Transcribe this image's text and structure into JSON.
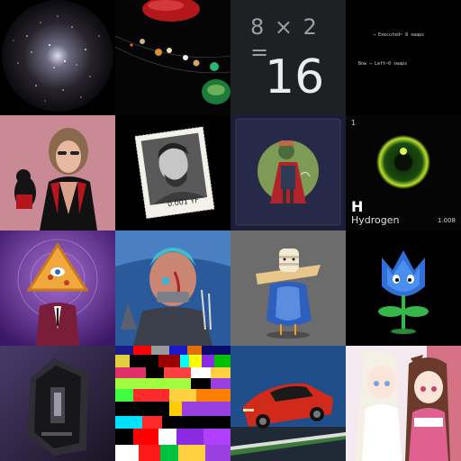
{
  "tiles": [
    {
      "id": "star-cluster"
    },
    {
      "id": "solar-system"
    },
    {
      "id": "math",
      "expression": "8 × 2 =",
      "result": "16"
    },
    {
      "id": "terminal",
      "header": "",
      "line1": "→  Executed~ 8 swaps",
      "line2": "Bow  →  Left~0 swaps"
    },
    {
      "id": "woman-with-dog"
    },
    {
      "id": "stamp-portrait",
      "caption": "0.001 YF"
    },
    {
      "id": "caped-character-card",
      "top_label": "",
      "bottom_left": "",
      "bottom_right": "",
      "footer": ""
    },
    {
      "id": "hydrogen-element",
      "number": "1",
      "symbol": "H",
      "name": "Hydrogen",
      "mass": "1.008"
    },
    {
      "id": "pizza-illuminati"
    },
    {
      "id": "cyber-warrior"
    },
    {
      "id": "mummy-bird"
    },
    {
      "id": "tulip-creature"
    },
    {
      "id": "coffin-device"
    },
    {
      "id": "pixel-glitch"
    },
    {
      "id": "red-sports-car"
    },
    {
      "id": "anime-catgirls"
    }
  ]
}
